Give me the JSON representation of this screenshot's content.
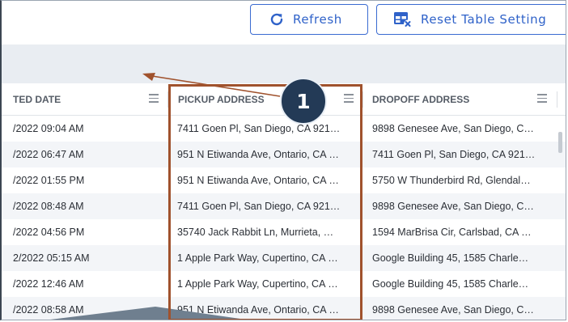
{
  "toolbar": {
    "refresh_label": "Refresh",
    "reset_label": "Reset Table Setting"
  },
  "table": {
    "columns": [
      {
        "label": "TED DATE"
      },
      {
        "label": "PICKUP ADDRESS"
      },
      {
        "label": "DROPOFF ADDRESS"
      }
    ],
    "rows": [
      {
        "date": "/2022 09:04 AM",
        "pickup": "7411 Goen Pl, San Diego, CA 921…",
        "dropoff": "9898 Genesee Ave, San Diego, C…"
      },
      {
        "date": "/2022 06:47 AM",
        "pickup": "951 N Etiwanda Ave, Ontario, CA …",
        "dropoff": "7411 Goen Pl, San Diego, CA 921…"
      },
      {
        "date": "/2022 01:55 PM",
        "pickup": "951 N Etiwanda Ave, Ontario, CA …",
        "dropoff": "5750 W Thunderbird Rd, Glendal…"
      },
      {
        "date": "/2022 08:48 AM",
        "pickup": "7411 Goen Pl, San Diego, CA 921…",
        "dropoff": "9898 Genesee Ave, San Diego, C…"
      },
      {
        "date": "/2022 04:56 PM",
        "pickup": "35740 Jack Rabbit Ln, Murrieta, …",
        "dropoff": "1594 MarBrisa Cir, Carlsbad, CA …"
      },
      {
        "date": "2/2022 05:15 AM",
        "pickup": "1 Apple Park Way, Cupertino, CA …",
        "dropoff": "Google Building 45, 1585 Charle…"
      },
      {
        "date": "/2022 12:46 AM",
        "pickup": "1 Apple Park Way, Cupertino, CA …",
        "dropoff": "Google Building 45, 1585 Charle…"
      },
      {
        "date": "/2022 08:58 AM",
        "pickup": "951 N Etiwanda Ave, Ontario, CA …",
        "dropoff": "9898 Genesee Ave, San Diego, C…"
      }
    ]
  },
  "callout": {
    "number": "1"
  },
  "colors": {
    "accent": "#2f62c9",
    "highlight": "#a0522d",
    "badge": "#233a56",
    "band": "#e9edf2"
  },
  "icons": {
    "refresh": "refresh-icon",
    "reset": "table-reset-icon",
    "column_menu": "column-menu-icon"
  }
}
